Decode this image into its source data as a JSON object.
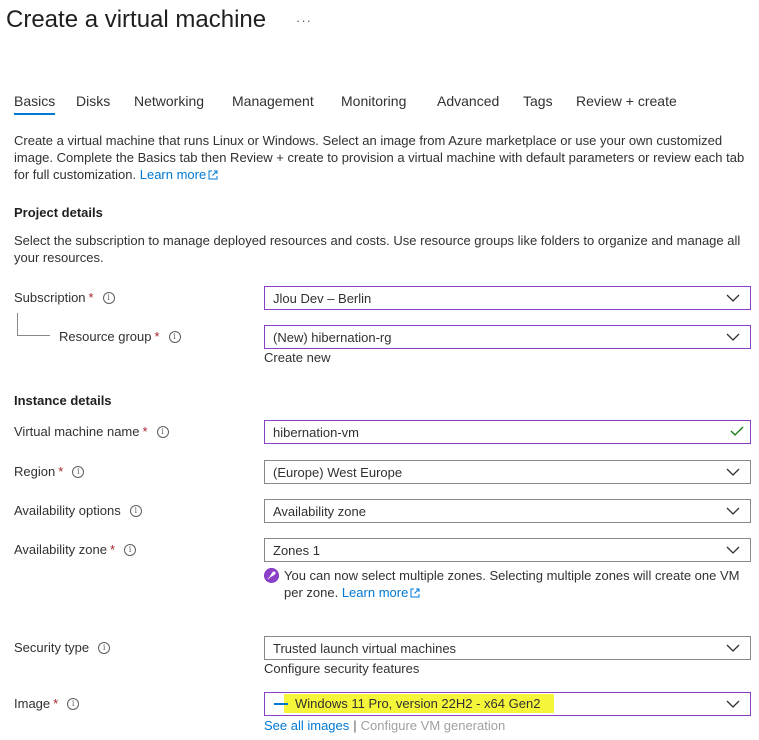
{
  "header": {
    "title": "Create a virtual machine",
    "more_icon": "ellipsis-icon"
  },
  "tabs": [
    {
      "label": "Basics",
      "active": true
    },
    {
      "label": "Disks"
    },
    {
      "label": "Networking"
    },
    {
      "label": "Management"
    },
    {
      "label": "Monitoring"
    },
    {
      "label": "Advanced"
    },
    {
      "label": "Tags"
    },
    {
      "label": "Review + create"
    }
  ],
  "intro": {
    "text": "Create a virtual machine that runs Linux or Windows. Select an image from Azure marketplace or use your own customized image. Complete the Basics tab then Review + create to provision a virtual machine with default parameters or review each tab for full customization.",
    "learn_more": "Learn more"
  },
  "project": {
    "heading": "Project details",
    "description": "Select the subscription to manage deployed resources and costs. Use resource groups like folders to organize and manage all your resources.",
    "subscription": {
      "label": "Subscription",
      "value": "Jlou Dev – Berlin"
    },
    "resource_group": {
      "label": "Resource group",
      "value": "(New) hibernation-rg",
      "create_new": "Create new"
    }
  },
  "instance": {
    "heading": "Instance details",
    "vm_name": {
      "label": "Virtual machine name",
      "value": "hibernation-vm"
    },
    "region": {
      "label": "Region",
      "value": "(Europe) West Europe"
    },
    "availability_options": {
      "label": "Availability options",
      "value": "Availability zone"
    },
    "availability_zone": {
      "label": "Availability zone",
      "value": "Zones 1",
      "notice": "You can now select multiple zones. Selecting multiple zones will create one VM per zone.",
      "notice_link": "Learn more"
    },
    "security_type": {
      "label": "Security type",
      "value": "Trusted launch virtual machines",
      "link": "Configure security features"
    },
    "image": {
      "label": "Image",
      "value": "Windows 11 Pro, version 22H2 - x64 Gen2",
      "see_all": "See all images",
      "separator": "|",
      "configure": "Configure VM generation"
    }
  },
  "colors": {
    "accent": "#0078d4",
    "focus_border": "#8a3fc6",
    "required": "#a4262c",
    "highlight": "#f5f53a",
    "valid": "#107c10"
  }
}
